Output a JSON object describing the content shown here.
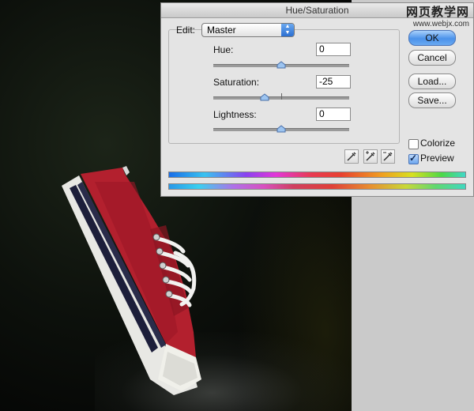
{
  "watermark": {
    "line1": "网页教学网",
    "line2": "www.webjx.com"
  },
  "dialog": {
    "title": "Hue/Saturation",
    "edit": {
      "label": "Edit:",
      "value": "Master"
    },
    "hue": {
      "label": "Hue:",
      "value": "0",
      "position": 0.5
    },
    "saturation": {
      "label": "Saturation:",
      "value": "-25",
      "position": 0.375
    },
    "lightness": {
      "label": "Lightness:",
      "value": "0",
      "position": 0.5
    },
    "buttons": {
      "ok": "OK",
      "cancel": "Cancel",
      "load": "Load...",
      "save": "Save..."
    },
    "colorize": {
      "label": "Colorize",
      "checked": false
    },
    "preview": {
      "label": "Preview",
      "checked": true
    },
    "eyedroppers": [
      "eyedropper-icon",
      "eyedropper-plus-icon",
      "eyedropper-minus-icon"
    ]
  }
}
